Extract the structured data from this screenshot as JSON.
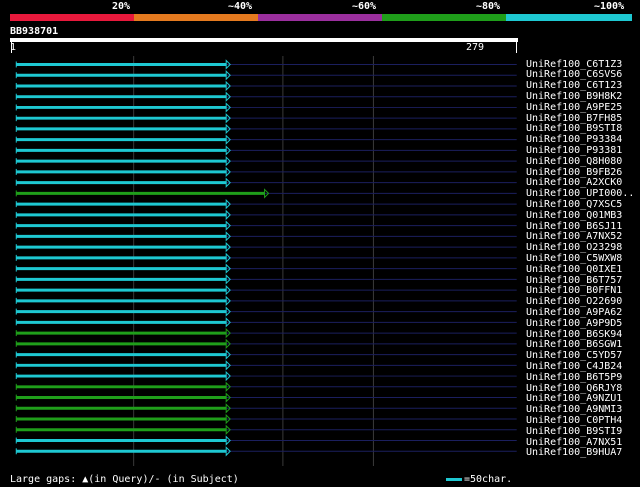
{
  "legend": {
    "labels": [
      "20%",
      "~40%",
      "~60%",
      "~80%",
      "~100%"
    ],
    "colors": [
      "#e8193c",
      "#e57a1f",
      "#9b2f9e",
      "#1f9e1a",
      "#1ec8d2"
    ]
  },
  "query": {
    "name": "BB938701",
    "start": "1",
    "end": "279"
  },
  "hits": [
    {
      "label": "UniRef100_C6T1Z3",
      "color": "#1ec8d2",
      "length": 279
    },
    {
      "label": "UniRef100_C6SVS6",
      "color": "#1ec8d2",
      "length": 279
    },
    {
      "label": "UniRef100_C6T123",
      "color": "#1ec8d2",
      "length": 279
    },
    {
      "label": "UniRef100_B9H8K2",
      "color": "#1ec8d2",
      "length": 279
    },
    {
      "label": "UniRef100_A9PE25",
      "color": "#1ec8d2",
      "length": 279
    },
    {
      "label": "UniRef100_B7FH85",
      "color": "#1ec8d2",
      "length": 279
    },
    {
      "label": "UniRef100_B9STI8",
      "color": "#1ec8d2",
      "length": 279
    },
    {
      "label": "UniRef100_P93384",
      "color": "#1ec8d2",
      "length": 279
    },
    {
      "label": "UniRef100_P93381",
      "color": "#1ec8d2",
      "length": 279
    },
    {
      "label": "UniRef100_Q8H080",
      "color": "#1ec8d2",
      "length": 279
    },
    {
      "label": "UniRef100_B9FB26",
      "color": "#1ec8d2",
      "length": 279
    },
    {
      "label": "UniRef100_A2XCK0",
      "color": "#1ec8d2",
      "length": 279
    },
    {
      "label": "UniRef100_UPI000..",
      "color": "#1f9e1a",
      "length": 330
    },
    {
      "label": "UniRef100_Q7XSC5",
      "color": "#1ec8d2",
      "length": 279
    },
    {
      "label": "UniRef100_Q01MB3",
      "color": "#1ec8d2",
      "length": 279
    },
    {
      "label": "UniRef100_B6SJ11",
      "color": "#1ec8d2",
      "length": 279
    },
    {
      "label": "UniRef100_A7NX52",
      "color": "#1ec8d2",
      "length": 279
    },
    {
      "label": "UniRef100_O23298",
      "color": "#1ec8d2",
      "length": 279
    },
    {
      "label": "UniRef100_C5WXW8",
      "color": "#1ec8d2",
      "length": 279
    },
    {
      "label": "UniRef100_Q0IXE1",
      "color": "#1ec8d2",
      "length": 279
    },
    {
      "label": "UniRef100_B6T757",
      "color": "#1ec8d2",
      "length": 279
    },
    {
      "label": "UniRef100_B0FFN1",
      "color": "#1ec8d2",
      "length": 279
    },
    {
      "label": "UniRef100_O22690",
      "color": "#1ec8d2",
      "length": 279
    },
    {
      "label": "UniRef100_A9PA62",
      "color": "#1ec8d2",
      "length": 279
    },
    {
      "label": "UniRef100_A9P9D5",
      "color": "#1ec8d2",
      "length": 279
    },
    {
      "label": "UniRef100_B6SK94",
      "color": "#1f9e1a",
      "length": 279
    },
    {
      "label": "UniRef100_B6SGW1",
      "color": "#1f9e1a",
      "length": 279
    },
    {
      "label": "UniRef100_C5YD57",
      "color": "#1ec8d2",
      "length": 279
    },
    {
      "label": "UniRef100_C4JB24",
      "color": "#1ec8d2",
      "length": 279
    },
    {
      "label": "UniRef100_B6T5P9",
      "color": "#1ec8d2",
      "length": 279
    },
    {
      "label": "UniRef100_Q6RJY8",
      "color": "#1f9e1a",
      "length": 279
    },
    {
      "label": "UniRef100_A9NZU1",
      "color": "#1f9e1a",
      "length": 279
    },
    {
      "label": "UniRef100_A9NMI3",
      "color": "#1f9e1a",
      "length": 279
    },
    {
      "label": "UniRef100_C0PTH4",
      "color": "#1f9e1a",
      "length": 279
    },
    {
      "label": "UniRef100_B9STI9",
      "color": "#1f9e1a",
      "length": 279
    },
    {
      "label": "UniRef100_A7NX51",
      "color": "#1ec8d2",
      "length": 279
    },
    {
      "label": "UniRef100_B9HUA7",
      "color": "#1ec8d2",
      "length": 279
    }
  ],
  "footer": {
    "gaps_text": "Large gaps: ▲(in Query)/- (in Subject)",
    "scale_text": "=50char."
  }
}
